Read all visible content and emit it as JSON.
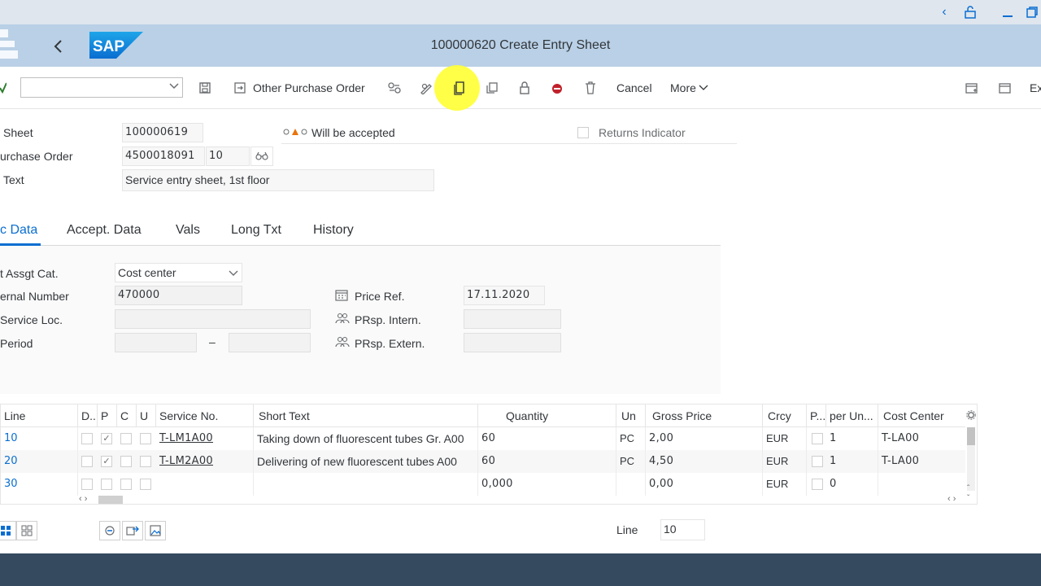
{
  "window": {
    "title": "100000620 Create Entry Sheet"
  },
  "toolbar": {
    "other_po_label": "Other Purchase Order",
    "cancel_label": "Cancel",
    "more_label": "More",
    "exit_label": "Ex"
  },
  "header": {
    "sheet_label": "Sheet",
    "sheet_value": "100000619",
    "status_text": "Will be accepted",
    "returns_label": "Returns Indicator",
    "po_label": "urchase Order",
    "po_value": "4500018091",
    "po_item": "10",
    "text_label": "Text",
    "text_value": "Service entry sheet, 1st floor"
  },
  "tabs": [
    {
      "label": "c Data"
    },
    {
      "label": "Accept. Data"
    },
    {
      "label": "Vals"
    },
    {
      "label": "Long Txt"
    },
    {
      "label": "History"
    }
  ],
  "basic_data": {
    "acct_label": "t Assgt Cat.",
    "acct_value": "Cost center",
    "ext_num_label": "ernal Number",
    "ext_num_value": "470000",
    "service_loc_label": "Service Loc.",
    "period_label": "Period",
    "period_sep": "–",
    "price_ref_label": "Price Ref.",
    "price_ref_value": "17.11.2020",
    "prsp_intern_label": "PRsp. Intern.",
    "prsp_extern_label": "PRsp. Extern."
  },
  "table": {
    "headers": [
      "Line",
      "D..",
      "P",
      "C",
      "U",
      "Service No.",
      "Short Text",
      "Quantity",
      "Un",
      "Gross Price",
      "Crcy",
      "P...",
      "per Un...",
      "Cost Center"
    ],
    "rows": [
      {
        "line": "10",
        "p_checked": "✓",
        "service_no": "T-LM1A00",
        "short_text": "Taking down of fluorescent tubes Gr. A00",
        "quantity": "60",
        "unit": "PC",
        "gross_price": "2,00",
        "currency": "EUR",
        "per_unit": "1",
        "cost_center": "T-LA00"
      },
      {
        "line": "20",
        "p_checked": "✓",
        "service_no": "T-LM2A00",
        "short_text": "Delivering of new fluorescent tubes A00",
        "quantity": "60",
        "unit": "PC",
        "gross_price": "4,50",
        "currency": "EUR",
        "per_unit": "1",
        "cost_center": "T-LA00"
      },
      {
        "line": "30",
        "p_checked": "",
        "service_no": "",
        "short_text": "",
        "quantity": "0,000",
        "unit": "",
        "gross_price": "0,00",
        "currency": "EUR",
        "per_unit": "0",
        "cost_center": ""
      }
    ]
  },
  "footer_bar": {
    "line_label": "Line",
    "line_value": "10"
  }
}
